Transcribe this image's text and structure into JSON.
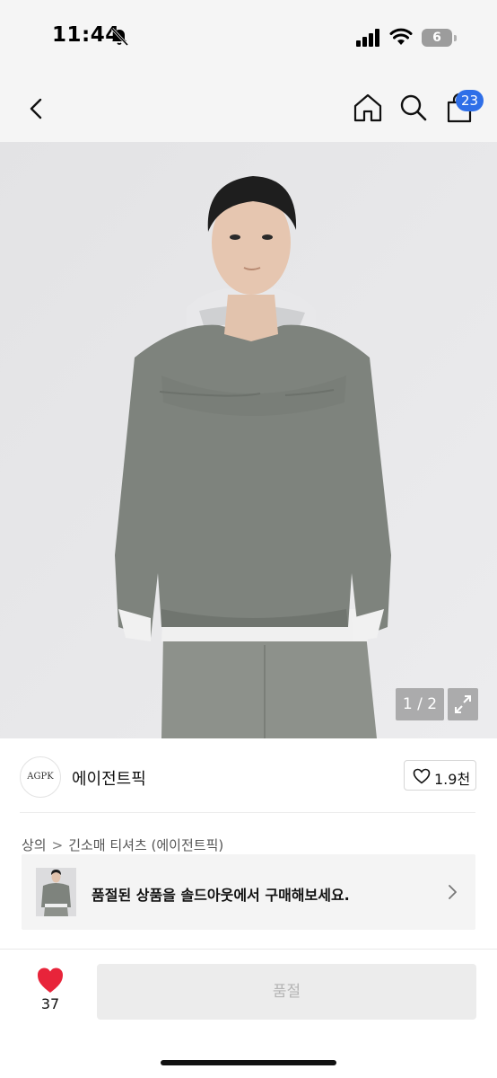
{
  "status_bar": {
    "time": "11:44",
    "battery_level": "6"
  },
  "nav": {
    "cart_count": "23"
  },
  "product_image": {
    "counter": "1 / 2"
  },
  "brand": {
    "logo_text": "AGPK",
    "name": "에이전트픽",
    "like_count": "1.9천"
  },
  "breadcrumb": {
    "category": "상의",
    "subcategory": "긴소매 티셔츠 (에이전트픽)"
  },
  "soldout_banner": {
    "text": "품절된 상품을 솔드아웃에서 구매해보세요."
  },
  "bottom_bar": {
    "like_count": "37",
    "buy_label": "품절"
  },
  "colors": {
    "accent_blue": "#2f6fe8",
    "heart_red": "#e8243a",
    "disabled_text": "#b5b5b5"
  }
}
